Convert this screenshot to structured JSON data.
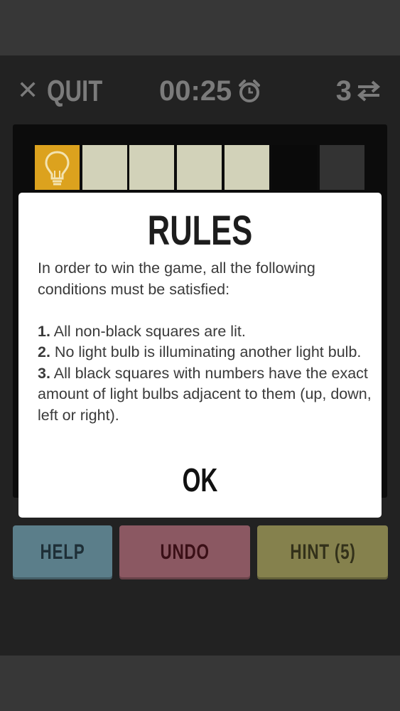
{
  "header": {
    "quit_label": "QUIT",
    "timer": "00:25",
    "level": "3"
  },
  "icons": {
    "close": "close-icon",
    "clock": "alarm-clock-icon",
    "swap": "swap-arrows-icon",
    "bulb": "light-bulb-icon"
  },
  "board": {
    "row0": [
      "bulb",
      "lit",
      "lit",
      "lit",
      "lit",
      "black",
      "dark"
    ]
  },
  "colors": {
    "background": "#222222",
    "lit": "#d2d2b9",
    "bulb": "#dca21e",
    "help": "#5b7e8a",
    "undo": "#8b5862",
    "hint": "#85814d"
  },
  "buttons": {
    "help": "HELP",
    "undo": "UNDO",
    "hint": "HINT (5)"
  },
  "modal": {
    "title": "RULES",
    "intro": "In order to win the game, all the following conditions must be satisfied:",
    "rules": [
      {
        "num": "1.",
        "text": "All non-black squares are lit."
      },
      {
        "num": "2.",
        "text": "No light bulb is illuminating another light bulb."
      },
      {
        "num": "3.",
        "text": "All black squares with numbers have the exact amount of light bulbs adjacent to them (up, down, left or right)."
      }
    ],
    "ok_label": "OK"
  }
}
